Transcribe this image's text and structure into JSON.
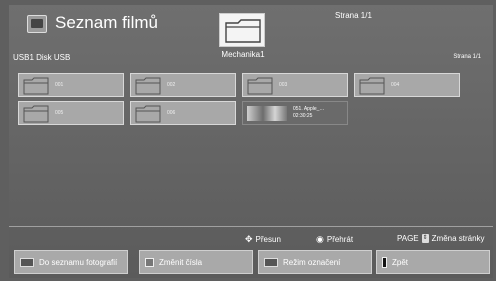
{
  "header": {
    "app_title": "Seznam filmů",
    "drive_label": "Mechanika1",
    "page_top": "Strana 1/1",
    "usb_label": "USB1  Disk USB",
    "page_right": "Strana 1/1"
  },
  "tiles": [
    {
      "name": "001"
    },
    {
      "name": "002"
    },
    {
      "name": "003"
    },
    {
      "name": "004"
    },
    {
      "name": "005"
    },
    {
      "name": "006"
    },
    {
      "name": "051. Apple_…",
      "duration": "02:30:25"
    }
  ],
  "hints": {
    "move": "Přesun",
    "play": "Přehrát",
    "page_key": "PAGE",
    "page_change": "Změna stránky"
  },
  "buttons": {
    "photos": "Do seznamu fotografií",
    "change_number": "Změnit čísla",
    "mark_mode": "Režim označení",
    "back": "Zpět"
  }
}
